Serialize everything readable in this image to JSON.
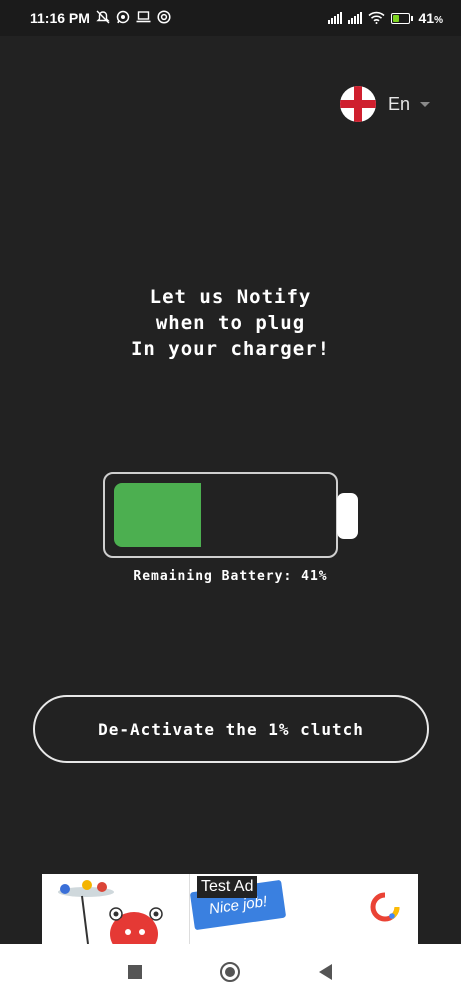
{
  "status_bar": {
    "time": "11:16 PM",
    "left_icons": [
      "mute-icon",
      "whatsapp-icon",
      "laptop-icon",
      "vpn-icon"
    ],
    "battery_percent_value": 41,
    "battery_percent_text": "41",
    "battery_percent_sign": "%"
  },
  "language": {
    "code": "En",
    "flag": "england-flag-icon"
  },
  "headline": {
    "line1": "Let us Notify",
    "line2": "when to plug",
    "line3": "In your charger!"
  },
  "battery": {
    "level_fraction": 0.41,
    "fill_color": "#4caf50",
    "remaining_text": "Remaining Battery: 41%"
  },
  "clutch_button": {
    "label": "De-Activate the 1% clutch"
  },
  "ad": {
    "label": "Test Ad",
    "ribbon_text": "Nice job!"
  },
  "nav": {
    "buttons": [
      "recents-icon",
      "home-icon",
      "back-icon"
    ]
  },
  "colors": {
    "background": "#222222",
    "accent_green": "#4caf50",
    "flag_red": "#cf1f2e"
  }
}
